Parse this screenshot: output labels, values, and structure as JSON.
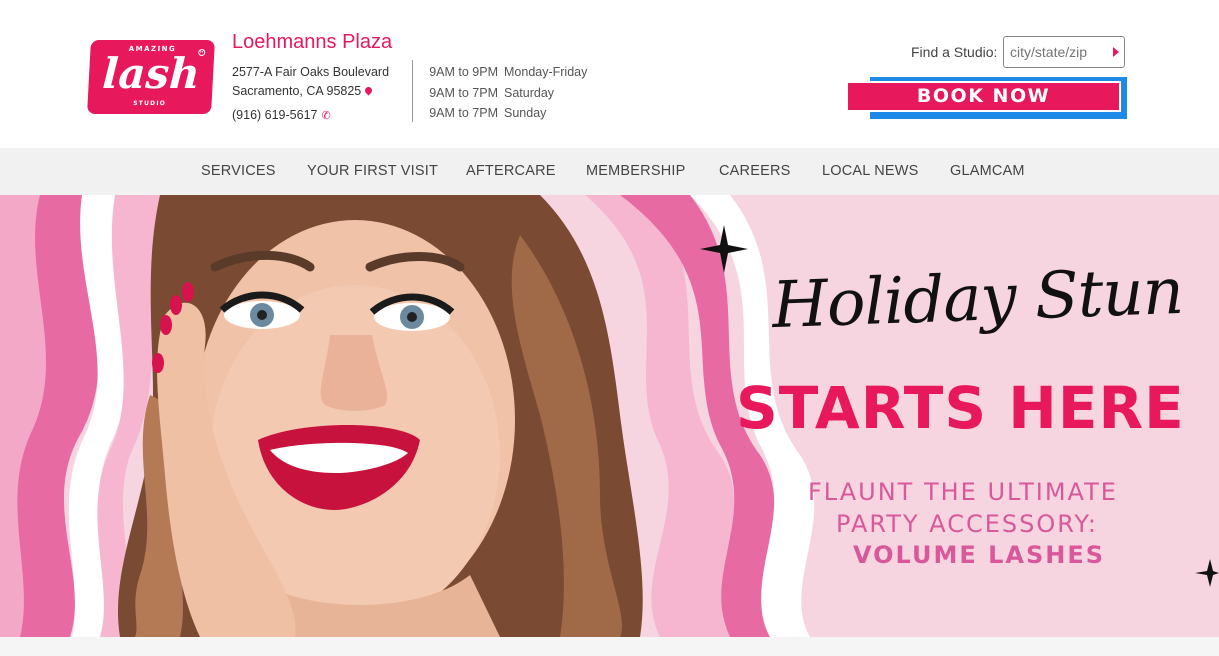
{
  "brand": {
    "logo_top": "AMAZING",
    "logo_main": "lash",
    "logo_bottom": "STUDIO"
  },
  "studio": {
    "name": "Loehmanns Plaza",
    "address_line1": "2577-A Fair Oaks Boulevard",
    "address_line2": "Sacramento, CA 95825",
    "phone": "(916) 619-5617"
  },
  "hours": [
    {
      "time": "9AM to 9PM",
      "days": "Monday-Friday"
    },
    {
      "time": "9AM to 7PM",
      "days": "Saturday"
    },
    {
      "time": "9AM to 7PM",
      "days": "Sunday"
    }
  ],
  "finder": {
    "label": "Find a Studio:",
    "placeholder": "city/state/zip"
  },
  "book_button": "BOOK NOW",
  "nav": [
    "SERVICES",
    "YOUR FIRST VISIT",
    "AFTERCARE",
    "MEMBERSHIP",
    "CAREERS",
    "LOCAL NEWS",
    "GLAMCAM"
  ],
  "hero": {
    "script": "Holiday Stun",
    "headline": "STARTS HERE",
    "sub1": "FLAUNT THE ULTIMATE",
    "sub2": "PARTY ACCESSORY:",
    "sub3": "VOLUME LASHES"
  },
  "colors": {
    "brand_pink": "#e8185c",
    "accent_blue": "#1e8ae8",
    "hero_bg": "#f6d5e1"
  }
}
